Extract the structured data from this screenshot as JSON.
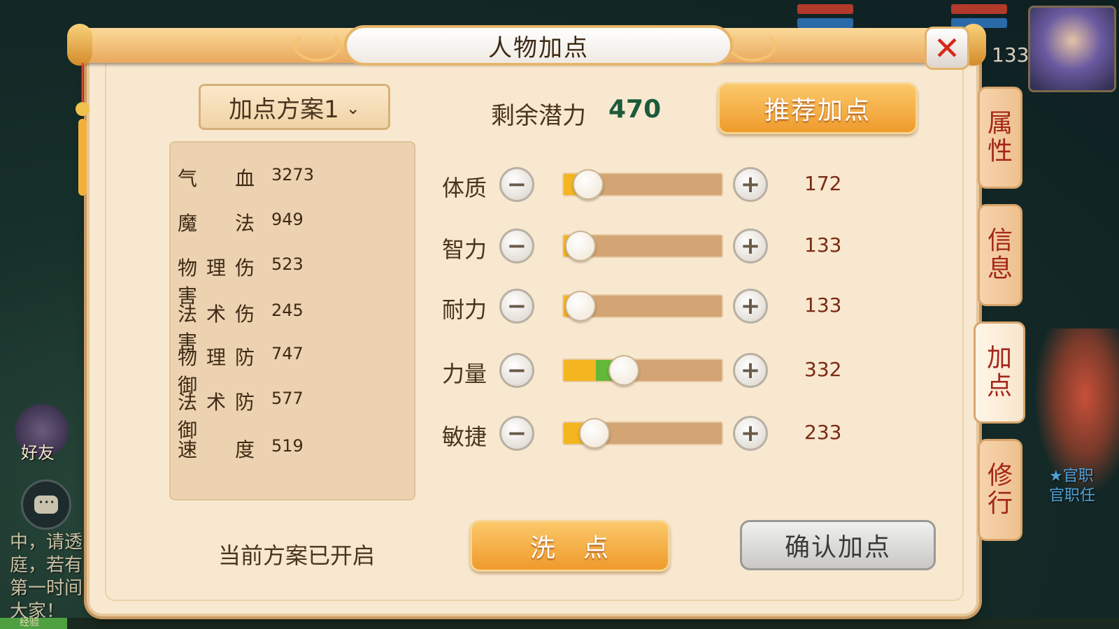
{
  "background": {
    "chat_text": [
      "中，请透",
      "庭，若有",
      "第一时间",
      "大家！"
    ],
    "friend_label": "好友",
    "hud_number": "133",
    "npc_text": [
      "★官职",
      "官职任"
    ],
    "exp_label": "经验"
  },
  "window": {
    "title": "人物加点",
    "close_icon": "close-icon"
  },
  "plan": {
    "selected": "加点方案1",
    "chevron": "⌄"
  },
  "potential": {
    "label": "剩余潜力",
    "value": "470"
  },
  "recommend_button": "推荐加点",
  "stats": [
    {
      "label": "气血",
      "value": "3273"
    },
    {
      "label": "魔法",
      "value": "949"
    },
    {
      "label": "物理伤害",
      "value": "523"
    },
    {
      "label": "法术伤害",
      "value": "245"
    },
    {
      "label": "物理防御",
      "value": "747"
    },
    {
      "label": "法术防御",
      "value": "577"
    },
    {
      "label": "速度",
      "value": "519"
    }
  ],
  "attributes": [
    {
      "label": "体质",
      "value": "172",
      "base_fill": 0.1,
      "added_fill": 0.0,
      "knob": 0.1
    },
    {
      "label": "智力",
      "value": "133",
      "base_fill": 0.05,
      "added_fill": 0.0,
      "knob": 0.05
    },
    {
      "label": "耐力",
      "value": "133",
      "base_fill": 0.05,
      "added_fill": 0.0,
      "knob": 0.05
    },
    {
      "label": "力量",
      "value": "332",
      "base_fill": 0.2,
      "added_fill": 0.12,
      "knob": 0.32
    },
    {
      "label": "敏捷",
      "value": "233",
      "base_fill": 0.14,
      "added_fill": 0.0,
      "knob": 0.14
    }
  ],
  "minus_symbol": "−",
  "plus_symbol": "+",
  "status_text": "当前方案已开启",
  "wash_button": "洗　点",
  "confirm_button": "确认加点",
  "side_tabs": [
    {
      "label": "属性",
      "active": false
    },
    {
      "label": "信息",
      "active": false
    },
    {
      "label": "加点",
      "active": true
    },
    {
      "label": "修行",
      "active": false
    }
  ],
  "colors": {
    "panel": "#f8e8cf",
    "accent_orange": "#ef9b2c",
    "potential_value": "#1b5b3c",
    "tab_text": "#a4261a",
    "bar_yellow": "#f3b520",
    "bar_green": "#62b838"
  }
}
